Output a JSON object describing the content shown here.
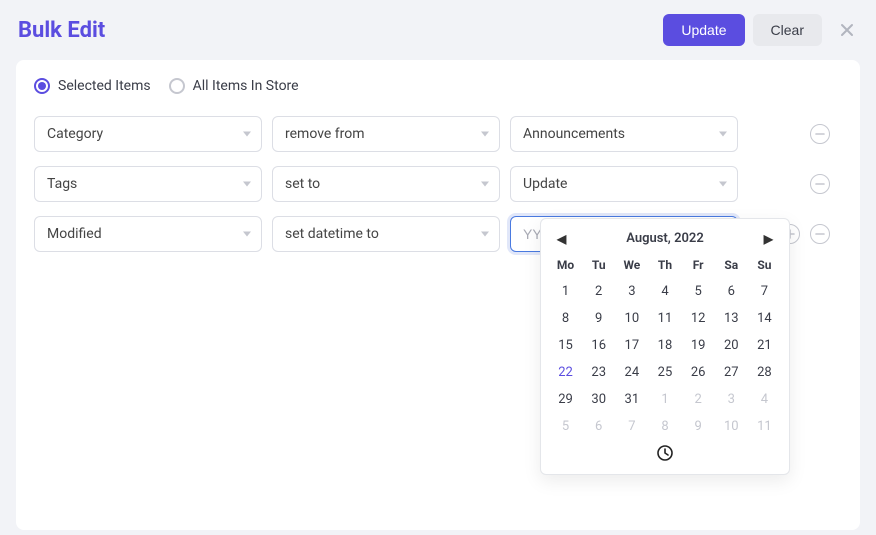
{
  "header": {
    "title": "Bulk Edit",
    "update": "Update",
    "clear": "Clear"
  },
  "scope": {
    "selected": "Selected Items",
    "all": "All Items In Store",
    "active": "selected"
  },
  "rules": [
    {
      "field": "Category",
      "action": "remove from",
      "value": "Announcements",
      "hasAdd": false
    },
    {
      "field": "Tags",
      "action": "set to",
      "value": "Update",
      "hasAdd": false
    },
    {
      "field": "Modified",
      "action": "set datetime to",
      "value": "",
      "placeholder": "YYYY-MM-DD HH:MM:SS",
      "isInput": true,
      "hasAdd": true
    }
  ],
  "datepicker": {
    "monthLabel": "August, 2022",
    "dow": [
      "Mo",
      "Tu",
      "We",
      "Th",
      "Fr",
      "Sa",
      "Su"
    ],
    "days": [
      {
        "d": 1
      },
      {
        "d": 2
      },
      {
        "d": 3
      },
      {
        "d": 4
      },
      {
        "d": 5
      },
      {
        "d": 6
      },
      {
        "d": 7
      },
      {
        "d": 8
      },
      {
        "d": 9
      },
      {
        "d": 10
      },
      {
        "d": 11
      },
      {
        "d": 12
      },
      {
        "d": 13
      },
      {
        "d": 14
      },
      {
        "d": 15
      },
      {
        "d": 16
      },
      {
        "d": 17
      },
      {
        "d": 18
      },
      {
        "d": 19
      },
      {
        "d": 20
      },
      {
        "d": 21
      },
      {
        "d": 22,
        "today": true
      },
      {
        "d": 23
      },
      {
        "d": 24
      },
      {
        "d": 25
      },
      {
        "d": 26
      },
      {
        "d": 27
      },
      {
        "d": 28
      },
      {
        "d": 29
      },
      {
        "d": 30
      },
      {
        "d": 31
      },
      {
        "d": 1,
        "out": true
      },
      {
        "d": 2,
        "out": true
      },
      {
        "d": 3,
        "out": true
      },
      {
        "d": 4,
        "out": true
      },
      {
        "d": 5,
        "out": true
      },
      {
        "d": 6,
        "out": true
      },
      {
        "d": 7,
        "out": true
      },
      {
        "d": 8,
        "out": true
      },
      {
        "d": 9,
        "out": true
      },
      {
        "d": 10,
        "out": true
      },
      {
        "d": 11,
        "out": true
      }
    ]
  }
}
